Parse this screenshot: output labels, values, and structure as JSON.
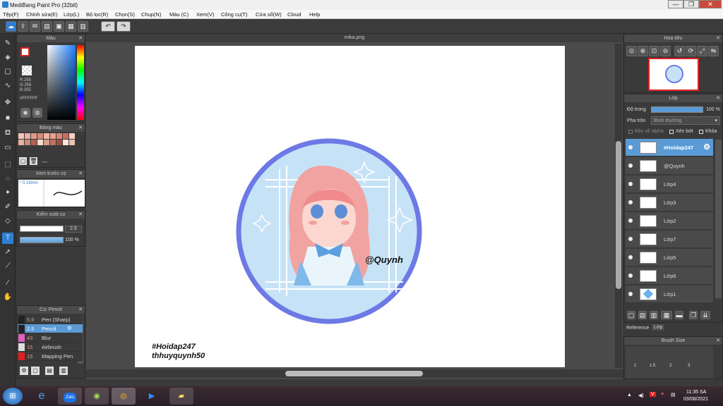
{
  "window": {
    "title": "MediBang Paint Pro (32bit)",
    "minimize": "—",
    "maximize": "❐",
    "close": "✕"
  },
  "menu": [
    "Tệp(F)",
    "Chỉnh sửa(E)",
    "Lớp(L)",
    "Bộ lọc(R)",
    "Chọn(S)",
    "Chụp(N)",
    "Màu (C)",
    "Xem(V)",
    "Công cụ(T)",
    "Cửa sổ(W)",
    "Cloud",
    "Help"
  ],
  "color_panel": {
    "title": "Màu",
    "rgb_r": "R:255",
    "rgb_g": "G:255",
    "rgb_b": "B:255",
    "hex": "#FFFFFF"
  },
  "palette_panel": {
    "title": "Bảng màu",
    "dash": "---"
  },
  "preview_panel": {
    "title": "Xem trước cọ",
    "size": "* 0.18mm"
  },
  "control_panel": {
    "title": "Kiểm soát cọ",
    "size_value": "2.5",
    "opacity_value": "100 %"
  },
  "brush_panel": {
    "title": "Cọ: Pencil",
    "items": [
      {
        "size": "5.6",
        "name": "Pen (Sharp)",
        "color": "#222222"
      },
      {
        "size": "2.5",
        "name": "Pencil",
        "color": "#222222"
      },
      {
        "size": "43",
        "name": "Blur",
        "color": "#e060c0"
      },
      {
        "size": "15",
        "name": "Airbrush",
        "color": "#dddddd"
      },
      {
        "size": "15",
        "name": "Mapping Pen",
        "color": "#e02020"
      }
    ]
  },
  "document": {
    "tab": "mika.png",
    "caption_line1": "#Hoidap247",
    "caption_line2": "thhuyquynh50",
    "watermark": "@Quynh"
  },
  "navigator_panel": {
    "title": "Hoa tiêu"
  },
  "layer_panel": {
    "title": "Lớp",
    "opacity_label": "Độ trong",
    "opacity_value": "100 %",
    "blend_label": "Pha trộn",
    "blend_value": "Bình thường",
    "protect_alpha": "Bảo vệ alpha",
    "clipping": "Xén bớt",
    "lock": "Khóa",
    "layers": [
      "#Hoidap247",
      "@Quynh",
      "Lớp4",
      "Lớp3",
      "Lớp2",
      "Lớp7",
      "Lớp5",
      "Lớp6",
      "Lớp1"
    ]
  },
  "tabs": {
    "reference": "Reference",
    "layer": "Lớp"
  },
  "brush_size_panel": {
    "title": "Brush Size",
    "labels": [
      "1",
      "1.5",
      "2",
      "3"
    ]
  },
  "taskbar": {
    "time": "11:35 SA",
    "date": "03/08/2021",
    "zalo": "Zalo"
  }
}
